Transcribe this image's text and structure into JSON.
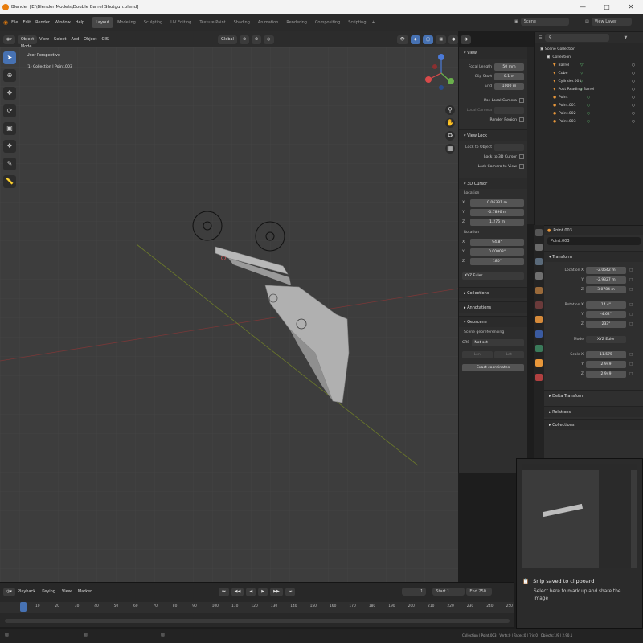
{
  "window": {
    "title": "Blender [E:\\Blender Models\\Double Barrel Shotgun.blend]",
    "min_icon": "minimize-icon",
    "max_icon": "maximize-icon",
    "close_icon": "close-icon"
  },
  "menu": [
    "File",
    "Edit",
    "Render",
    "Window",
    "Help"
  ],
  "workspaces": [
    "Layout",
    "Modeling",
    "Sculpting",
    "UV Editing",
    "Texture Paint",
    "Shading",
    "Animation",
    "Rendering",
    "Compositing",
    "Scripting"
  ],
  "workspace_add": "+",
  "scene": {
    "label": "Scene",
    "view_layer": "View Layer"
  },
  "viewport_header": {
    "mode": "Object Mode",
    "items": [
      "View",
      "Select",
      "Add",
      "Object",
      "GIS"
    ],
    "transform": "Global"
  },
  "viewport": {
    "perspective": "User Perspective",
    "collection": "(1) Collection | Point.003"
  },
  "npanel": {
    "view_title": "View",
    "focal_length_label": "Focal Length",
    "focal_length": "50 mm",
    "clip_start_label": "Clip Start",
    "clip_start": "0.1 m",
    "clip_end_label": "End",
    "clip_end": "1000 m",
    "use_local_camera": "Use Local Camera",
    "local_camera": "Local Camera",
    "render_region": "Render Region",
    "view_lock_title": "View Lock",
    "lock_to_object": "Lock to Object",
    "lock_to_cursor": "Lock to 3D Cursor",
    "lock_camera": "Lock Camera to View",
    "cursor_title": "3D Cursor",
    "location_label": "Location",
    "cursor_loc": [
      {
        "axis": "X",
        "value": "0.06331 m"
      },
      {
        "axis": "Y",
        "value": "-0.7896 m"
      },
      {
        "axis": "Z",
        "value": "1.276 m"
      }
    ],
    "rotation_label": "Rotation",
    "cursor_rot": [
      {
        "axis": "X",
        "value": "94.8°"
      },
      {
        "axis": "Y",
        "value": "0.00003°"
      },
      {
        "axis": "Z",
        "value": "180°"
      }
    ],
    "rotation_mode": "XYZ Euler",
    "collections": "Collections",
    "annotations": "Annotations",
    "geoscene": "Geoscene",
    "scene_georef": "Scene georeferencing",
    "crs": "CRS",
    "crs_value": "Not set",
    "geo_x": "Lon",
    "geo_y": "Lat",
    "exact_coords": "Exact coordinates"
  },
  "outliner": {
    "root": "Scene Collection",
    "rows": [
      {
        "name": "Collection",
        "icon": "collection-icon"
      },
      {
        "name": "Barrel",
        "icon": "object-icon"
      },
      {
        "name": "Cube",
        "icon": "object-icon"
      },
      {
        "name": "Cylinder.001",
        "icon": "object-icon"
      },
      {
        "name": "Post Reading Barrel",
        "icon": "object-icon"
      },
      {
        "name": "Point",
        "icon": "light-icon"
      },
      {
        "name": "Point.001",
        "icon": "light-icon"
      },
      {
        "name": "Point.002",
        "icon": "light-icon"
      },
      {
        "name": "Point.003",
        "icon": "light-icon"
      }
    ]
  },
  "properties": {
    "object": "Point.003",
    "object_name": "Point.003",
    "transform": "Transform",
    "location_label": "Location X",
    "location": [
      "-2.0642 m",
      "-2.9327 m",
      "3.0784 m"
    ],
    "rotation_label": "Rotation X",
    "rotation": [
      "14.4°",
      "-4.62°",
      "233°"
    ],
    "mode_label": "Mode",
    "mode": "XYZ Euler",
    "scale_label": "Scale X",
    "scale": [
      "11.575",
      "2.949",
      "2.949"
    ],
    "delta": "Delta Transform",
    "relations": "Relations",
    "collections": "Collections"
  },
  "timeline": {
    "menus": [
      "Playback",
      "Keying",
      "View",
      "Marker"
    ],
    "current_frame": "1",
    "start_label": "Start",
    "start": "1",
    "end_label": "End",
    "end": "250",
    "ruler": [
      "10",
      "20",
      "30",
      "40",
      "50",
      "60",
      "70",
      "80",
      "90",
      "100",
      "110",
      "120",
      "130",
      "140",
      "150",
      "160",
      "170",
      "180",
      "190",
      "200",
      "210",
      "220",
      "230",
      "240",
      "250"
    ]
  },
  "snip": {
    "title": "Snip saved to clipboard",
    "body": "Select here to mark up and share the image"
  },
  "statusbar": {
    "text": "Collection | Point.003 | Verts:0 | Faces:0 | Tris:0 | Objects:1/9 | 2.90.1"
  },
  "colors": {
    "accent": "#4772b3",
    "light": "#e8973a",
    "grid": "#545454"
  }
}
